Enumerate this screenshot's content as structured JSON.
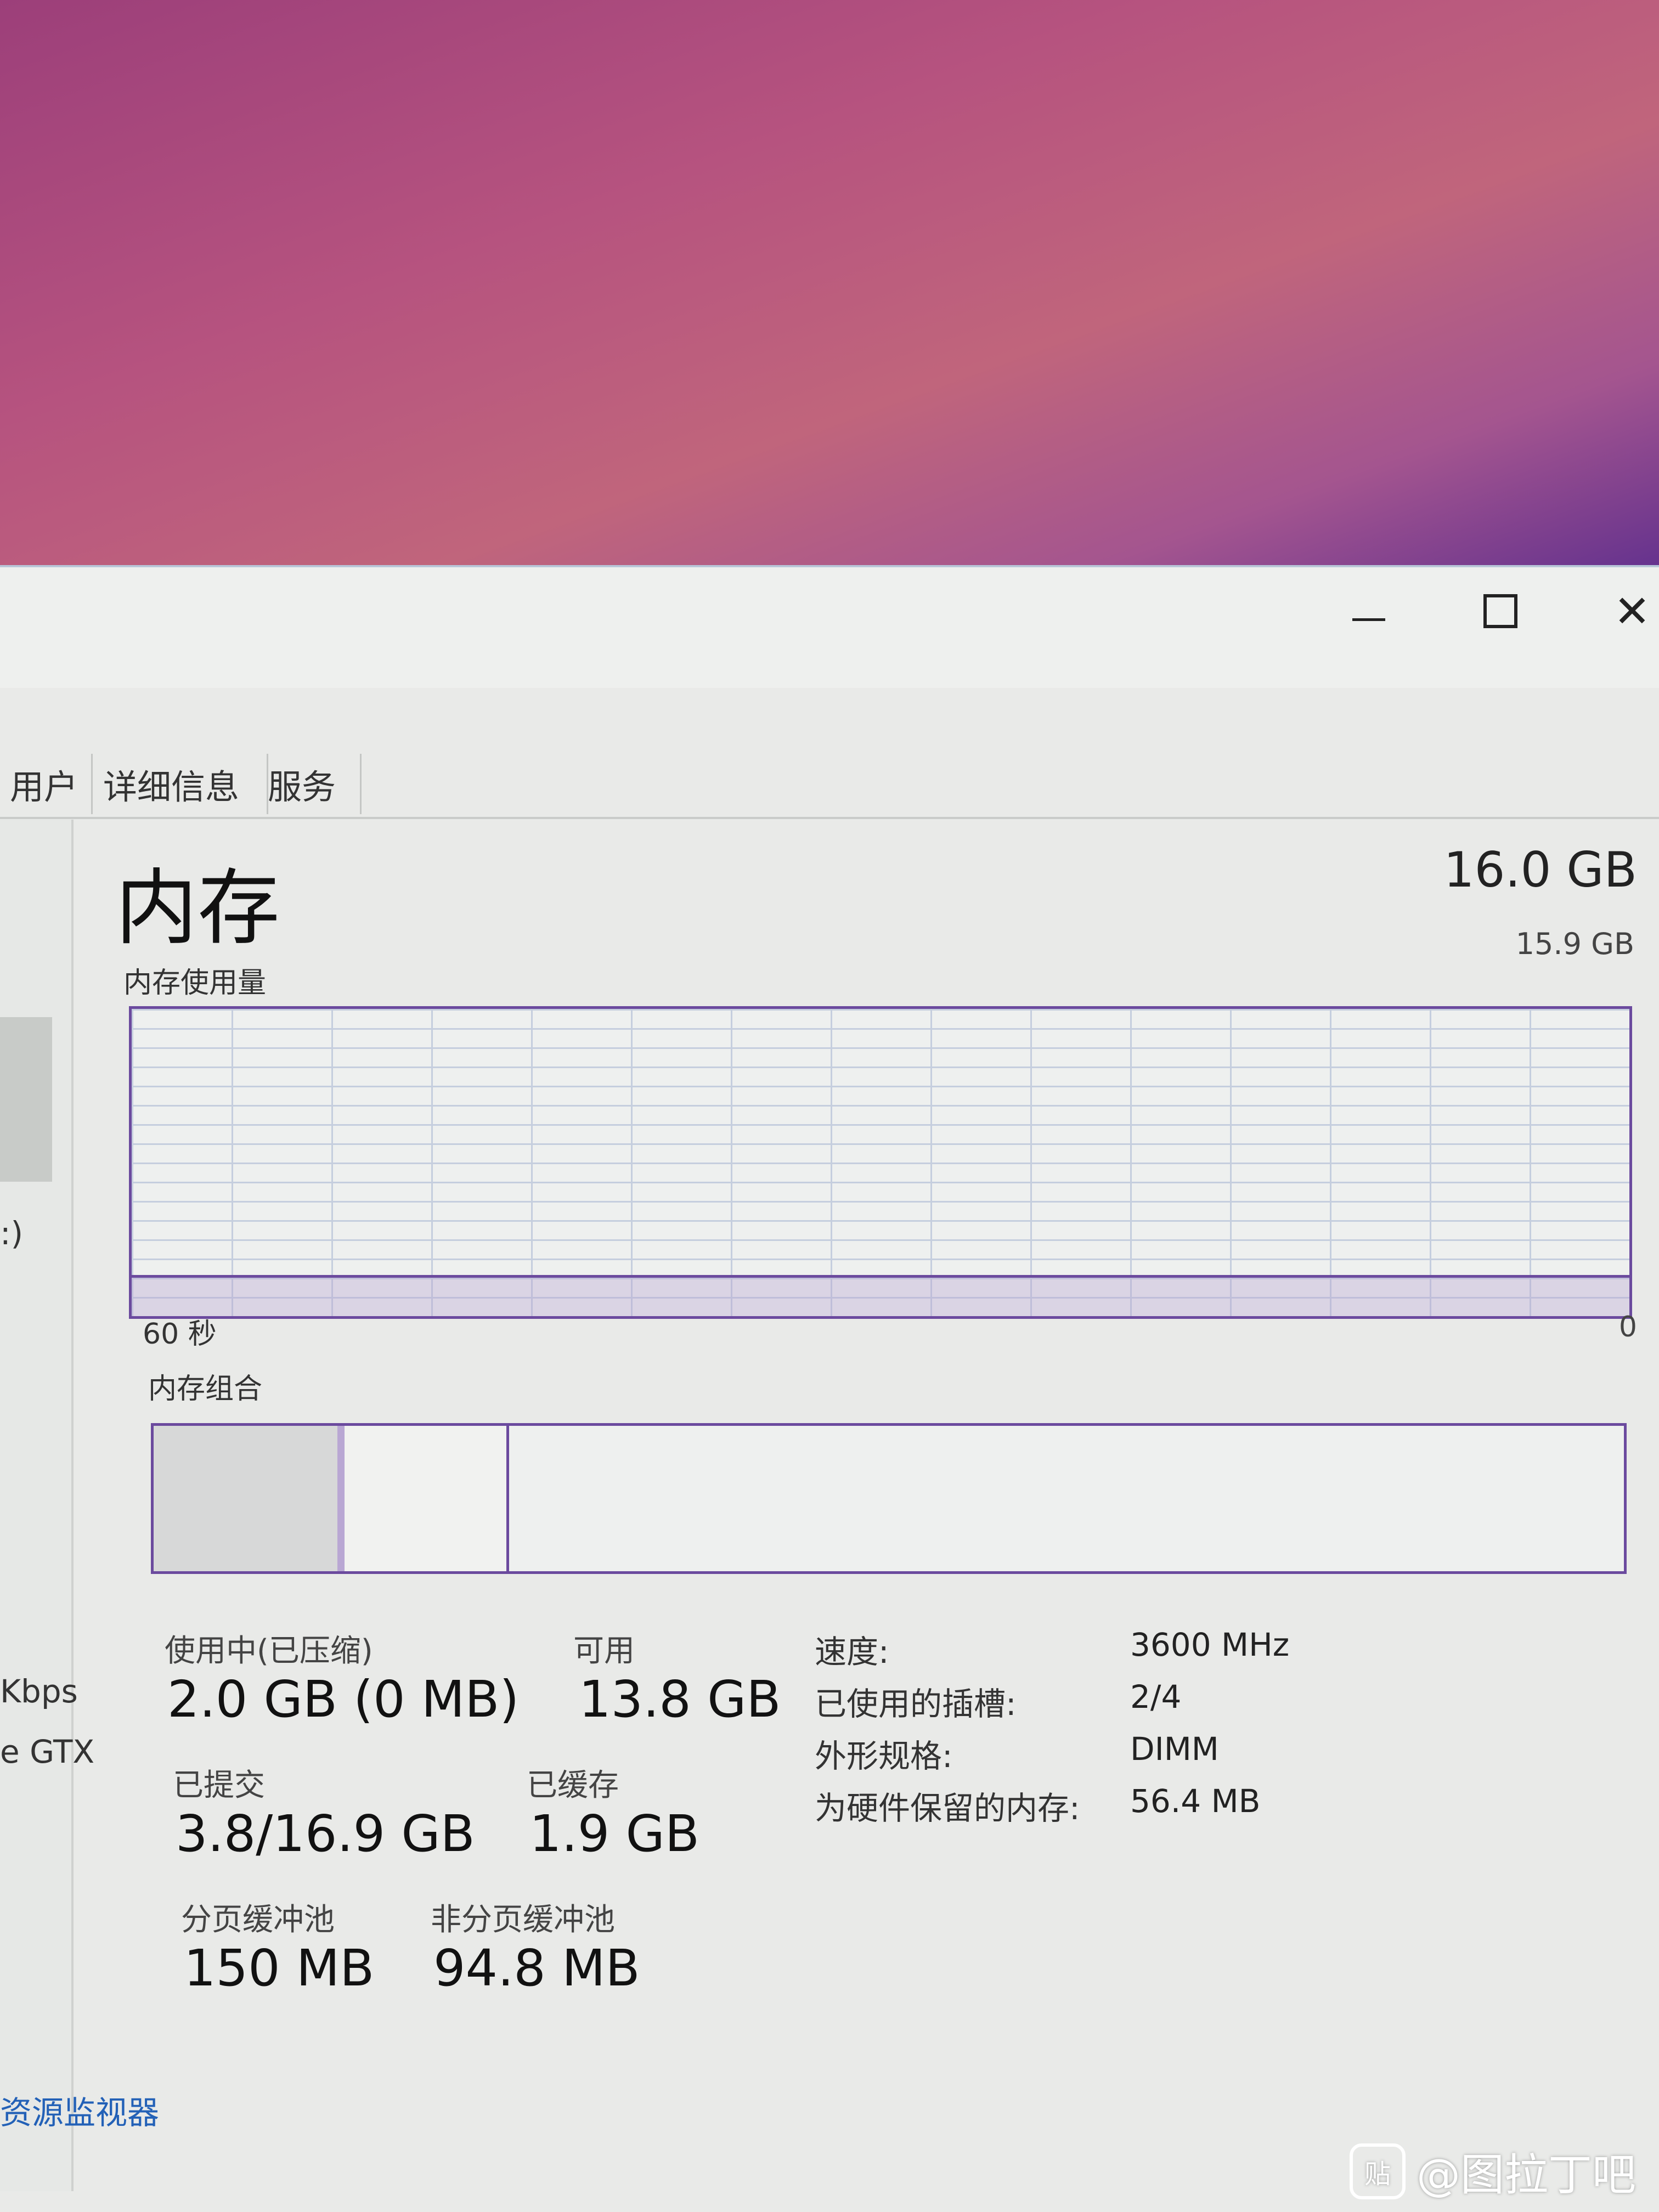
{
  "window": {
    "controls": [
      "minimize",
      "maximize",
      "close"
    ]
  },
  "tabs": [
    "用户",
    "详细信息",
    "服务"
  ],
  "sidebar": {
    "fragments": [
      ":)",
      "Kbps",
      "e GTX"
    ]
  },
  "memory": {
    "title": "内存",
    "total": "16.0 GB",
    "usage_label": "内存使用量",
    "graph_max": "15.9 GB",
    "time_span": "60 秒",
    "graph_min": "0",
    "composition_label": "内存组合",
    "usage_fraction": 0.125,
    "composition": {
      "in_use_fraction": 0.125,
      "modified_fraction": 0.005,
      "standby_fraction": 0.11
    }
  },
  "stats": {
    "in_use_label": "使用中(已压缩)",
    "in_use_value": "2.0 GB (0 MB)",
    "available_label": "可用",
    "available_value": "13.8 GB",
    "committed_label": "已提交",
    "committed_value": "3.8/16.9 GB",
    "cached_label": "已缓存",
    "cached_value": "1.9 GB",
    "paged_label": "分页缓冲池",
    "paged_value": "150 MB",
    "nonpaged_label": "非分页缓冲池",
    "nonpaged_value": "94.8 MB"
  },
  "details": {
    "speed_label": "速度:",
    "speed_value": "3600 MHz",
    "slots_label": "已使用的插槽:",
    "slots_value": "2/4",
    "form_label": "外形规格:",
    "form_value": "DIMM",
    "reserved_label": "为硬件保留的内存:",
    "reserved_value": "56.4 MB"
  },
  "footer": {
    "resource_monitor": "资源监视器"
  },
  "watermark": {
    "icon": "贴",
    "text": "@图拉丁吧"
  }
}
